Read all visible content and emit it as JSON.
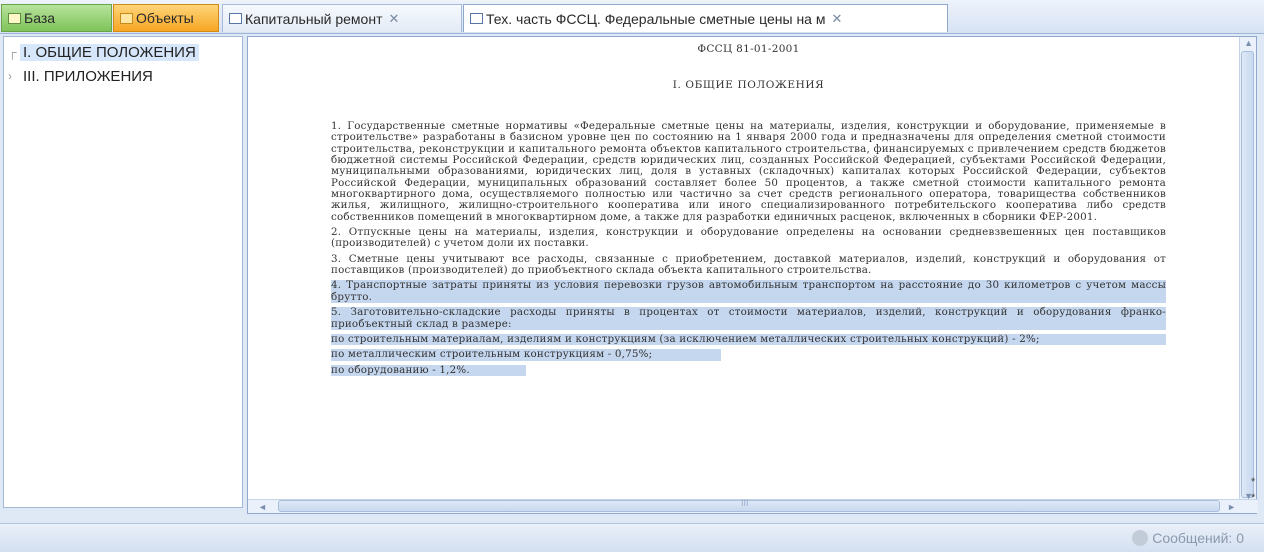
{
  "tabs": [
    {
      "label": "База",
      "icon": "database-icon"
    },
    {
      "label": "Объекты",
      "icon": "folder-icon"
    },
    {
      "label": "Капитальный ремонт",
      "icon": "document-icon",
      "close": "✕"
    },
    {
      "label": "Тех. часть ФССЦ. Федеральные сметные цены на м",
      "icon": "page-icon",
      "close": "✕"
    }
  ],
  "tree": {
    "items": [
      {
        "label": "I. ОБЩИЕ ПОЛОЖЕНИЯ",
        "selected": true
      },
      {
        "label": "III. ПРИЛОЖЕНИЯ",
        "selected": false
      }
    ]
  },
  "document": {
    "header": "ФССЦ 81-01-2001",
    "section_title": "I. ОБЩИЕ ПОЛОЖЕНИЯ",
    "paragraphs": [
      "1. Государственные сметные нормативы «Федеральные сметные цены на материалы, изделия, конструкции и оборудование, применяемые в строительстве» разработаны в базисном уровне цен по состоянию на 1 января 2000 года и предназначены для определения сметной стоимости строительства, реконструкции и капитального ремонта объектов капитального строительства, финансируемых с привлечением средств бюджетов бюджетной системы Российской Федерации, средств юридических лиц, созданных Российской Федерацией, субъектами Российской Федерации, муниципальными образованиями, юридических лиц, доля в уставных (складочных) капиталах которых Российской Федерации, субъектов Российской Федерации, муниципальных образований составляет более 50 процентов, а также сметной стоимости капитального ремонта многоквартирного дома, осуществляемого полностью или частично за счет средств регионального оператора, товарищества собственников жилья, жилищного, жилищно-строительного кооператива или иного специализированного потребительского кооператива либо средств собственников помещений в многоквартирном доме, а также для разработки единичных расценок, включенных в сборники ФЕР-2001.",
      "2. Отпускные цены на материалы, изделия, конструкции и оборудование определены на основании средневзвешенных цен поставщиков (производителей) с учетом доли их поставки.",
      "3. Сметные цены учитывают все расходы, связанные с приобретением, доставкой материалов, изделий, конструкций и оборудования от поставщиков (производителей) до приобъектного склада объекта капитального строительства.",
      "4. Транспортные затраты приняты из условия перевозки грузов автомобильным транспортом на расстояние до 30 километров с учетом массы брутто.",
      "5. Заготовительно-складские расходы приняты в процентах от стоимости материалов, изделий, конструкций и оборудования франко-приобъектный склад в размере:",
      "по строительным материалам, изделиям и конструкциям (за исключением металлических строительных конструкций) - 2%;",
      "по металлическим строительным конструкциям - 0,75%;",
      "по оборудованию - 1,2%."
    ],
    "highlighted_from_index": 3
  },
  "scrollbars": {
    "h_grip": "III",
    "up": "▲",
    "down": "▼",
    "left": "◄",
    "right": "►"
  },
  "side_markers": [
    "*",
    "*"
  ],
  "status": {
    "messages_label": "Сообщений: 0"
  },
  "colors": {
    "highlight": "#c5d7ef",
    "tab_green": "#7fc35a",
    "tab_orange": "#f6a623"
  }
}
